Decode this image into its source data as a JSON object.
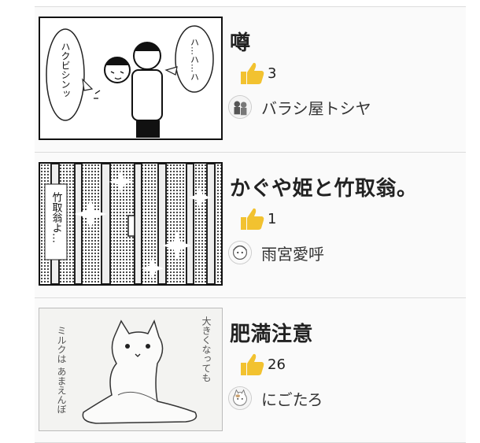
{
  "posts": [
    {
      "title": "噂",
      "likes": "3",
      "author": "バラシ屋トシヤ",
      "thumb_text_left": "ハクビシンッ",
      "thumb_text_right": "ハ…ハ…ハ"
    },
    {
      "title": "かぐや姫と竹取翁。",
      "likes": "1",
      "author": "雨宮愛呼",
      "thumb_text": "竹取翁よ…"
    },
    {
      "title": "肥満注意",
      "likes": "26",
      "author": "にごたろ",
      "thumb_text_left": "ミルクは あまえんぼ",
      "thumb_text_right": "大きくなっても"
    }
  ],
  "colors": {
    "like_icon": "#f2c230",
    "border": "#dcdcdc",
    "title": "#222222"
  },
  "icons": {
    "like": "thumbs-up-icon"
  }
}
